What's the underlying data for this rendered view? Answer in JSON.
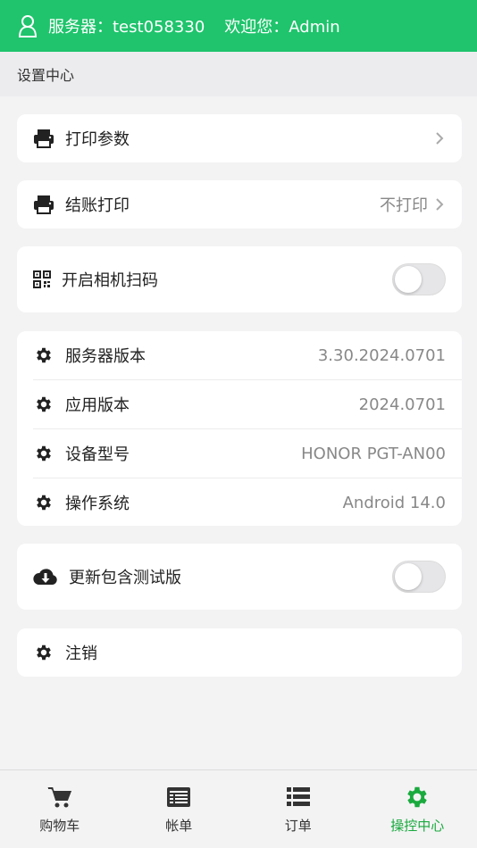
{
  "header": {
    "server_text": "服务器：test058330",
    "welcome_text": "欢迎您：Admin"
  },
  "subheader": {
    "title": "设置中心"
  },
  "settings": {
    "print_params": {
      "label": "打印参数"
    },
    "checkout_print": {
      "label": "结账打印",
      "value": "不打印"
    },
    "camera_scan": {
      "label": "开启相机扫码",
      "enabled": false
    },
    "server_version": {
      "label": "服务器版本",
      "value": "3.30.2024.0701"
    },
    "app_version": {
      "label": "应用版本",
      "value": "2024.0701"
    },
    "device_model": {
      "label": "设备型号",
      "value": "HONOR PGT-AN00"
    },
    "os": {
      "label": "操作系统",
      "value": "Android 14.0"
    },
    "beta_updates": {
      "label": "更新包含测试版",
      "enabled": false
    },
    "logout": {
      "label": "注销"
    }
  },
  "tabbar": {
    "tabs": [
      {
        "label": "购物车",
        "icon": "cart-icon"
      },
      {
        "label": "帐单",
        "icon": "bill-icon"
      },
      {
        "label": "订单",
        "icon": "list-icon"
      },
      {
        "label": "操控中心",
        "icon": "gear-icon"
      }
    ],
    "active_index": 3
  },
  "colors": {
    "brand": "#1fc46c",
    "active_tab": "#1aaa3e"
  }
}
